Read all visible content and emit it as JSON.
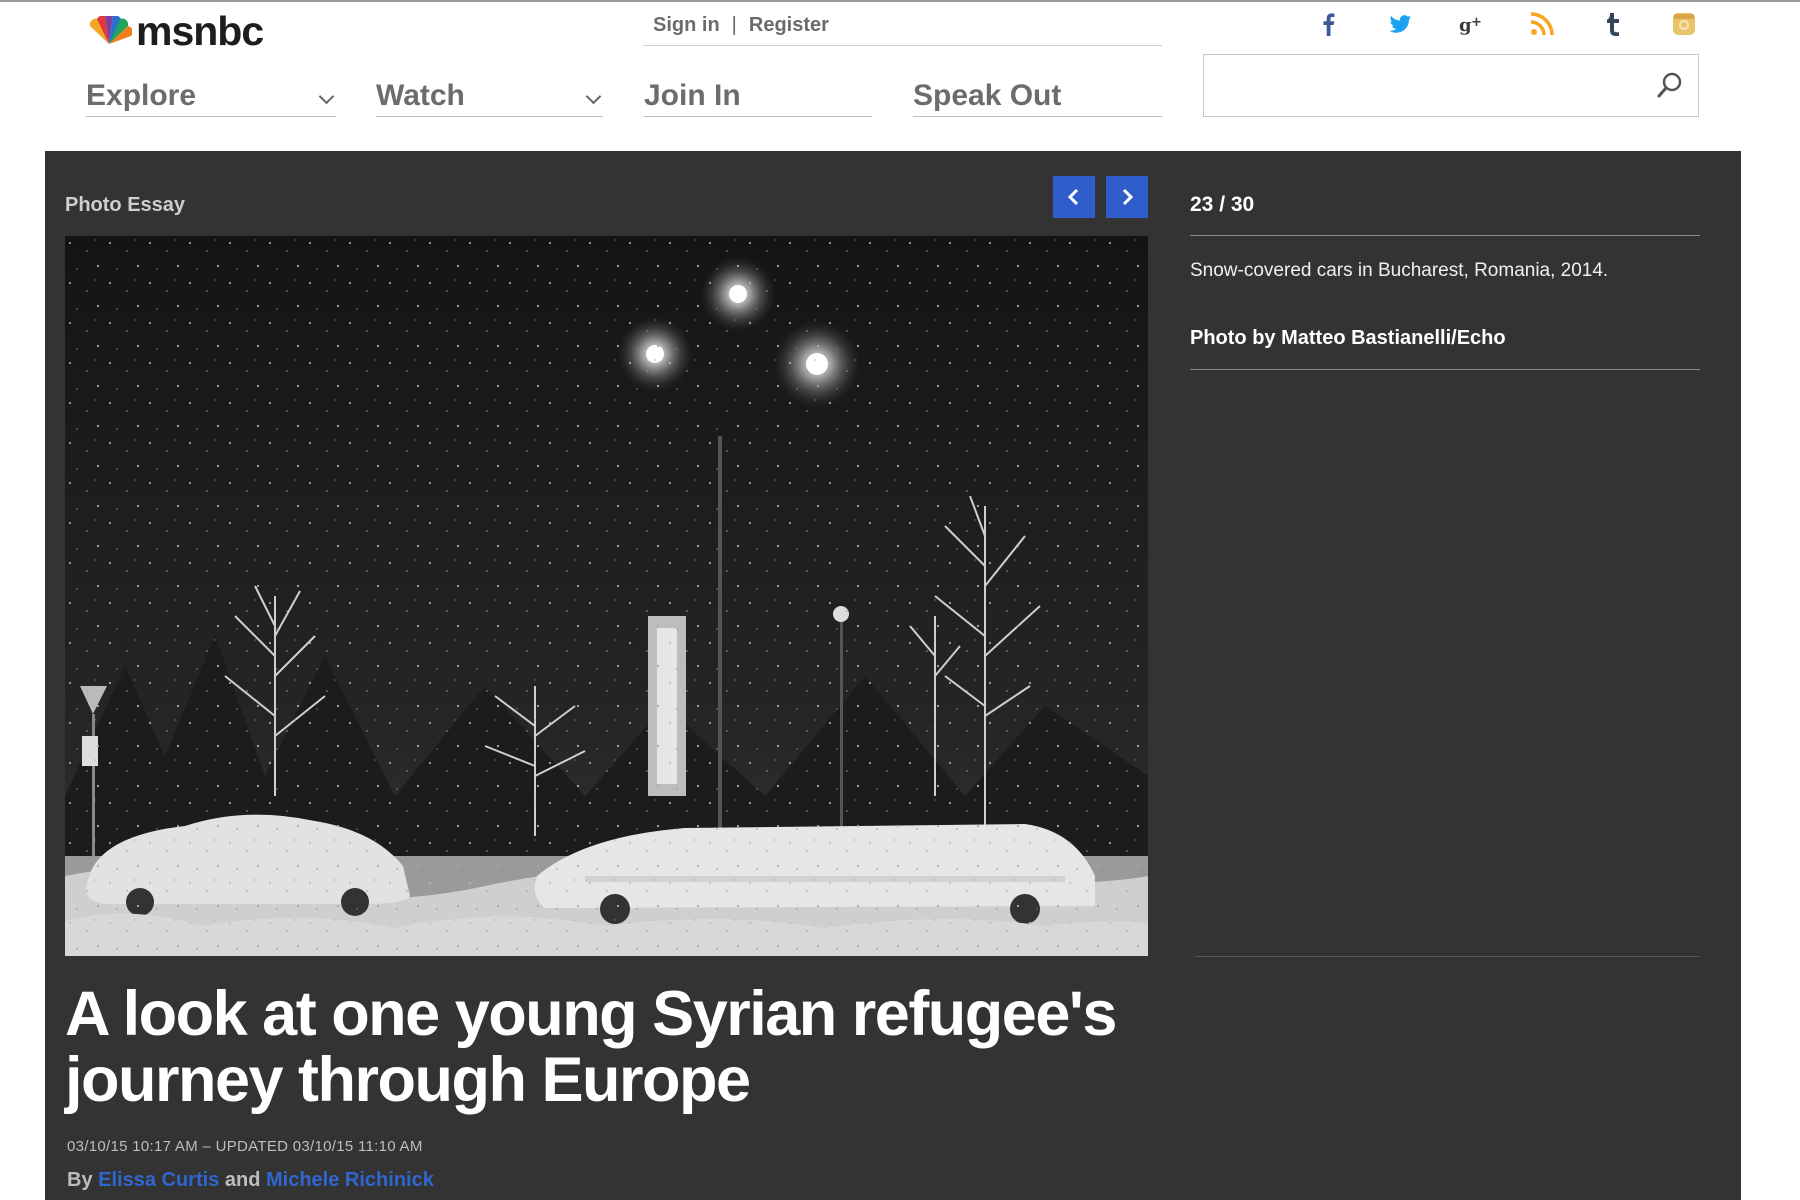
{
  "header": {
    "logo_text": "msnbc",
    "sign_in": "Sign in",
    "separator": "|",
    "register": "Register",
    "nav": [
      {
        "label": "Explore"
      },
      {
        "label": "Watch"
      },
      {
        "label": "Join In"
      },
      {
        "label": "Speak Out"
      }
    ],
    "social_icons": [
      "facebook-icon",
      "twitter-icon",
      "google-plus-icon",
      "rss-icon",
      "tumblr-icon",
      "instagram-icon"
    ],
    "search": {
      "placeholder": "",
      "value": ""
    }
  },
  "gallery": {
    "section_label": "Photo Essay",
    "counter": "23 / 30",
    "caption": "Snow-covered cars in Bucharest, Romania, 2014.",
    "credit": "Photo by Matteo Bastianelli/Echo"
  },
  "article": {
    "headline": "A look at one young Syrian refugee's journey through Europe",
    "dateline": "03/10/15 10:17 AM – UPDATED 03/10/15 11:10 AM",
    "byline_prefix": "By",
    "author_1": "Elissa Curtis",
    "byline_and": "and",
    "author_2": "Michele Richinick"
  },
  "colors": {
    "gallery_bg": "#333333",
    "accent_blue": "#2f5dc9",
    "link_blue": "#2f66cf",
    "facebook": "#3b5998",
    "twitter": "#1da1f2",
    "rss": "#f6a623",
    "tumblr": "#35465c",
    "instagram": "#e9c46a"
  }
}
